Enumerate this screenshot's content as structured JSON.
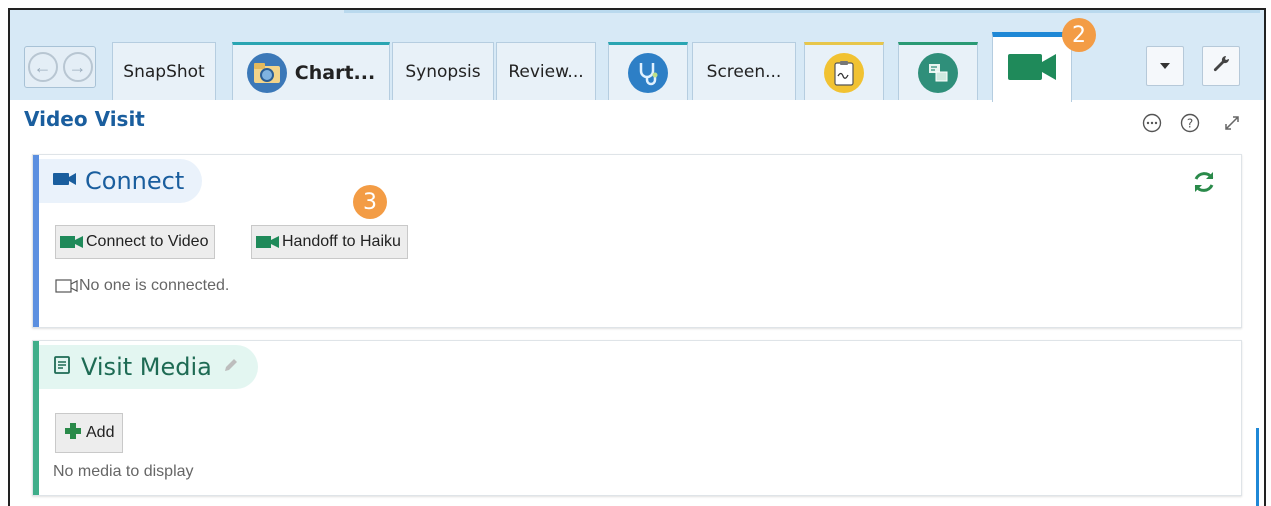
{
  "tabs": [
    {
      "label": "SnapShot"
    },
    {
      "label": "Chart..."
    },
    {
      "label": "Synopsis"
    },
    {
      "label": "Review..."
    },
    {
      "label": "Screen..."
    }
  ],
  "badges": {
    "tab_badge": "2",
    "handoff_badge": "3"
  },
  "header": {
    "title": "Video Visit"
  },
  "connect": {
    "title": "Connect",
    "connect_button": "Connect to Video",
    "handoff_button": "Handoff to Haiku",
    "status": "No one is connected."
  },
  "media": {
    "title": "Visit Media",
    "add_button": "Add",
    "empty_text": "No media to display"
  },
  "colors": {
    "brand_blue": "#1a5e9e",
    "accent_green": "#1f8a5a",
    "badge_orange": "#f39c45",
    "active_tab": "#1f88d6"
  }
}
